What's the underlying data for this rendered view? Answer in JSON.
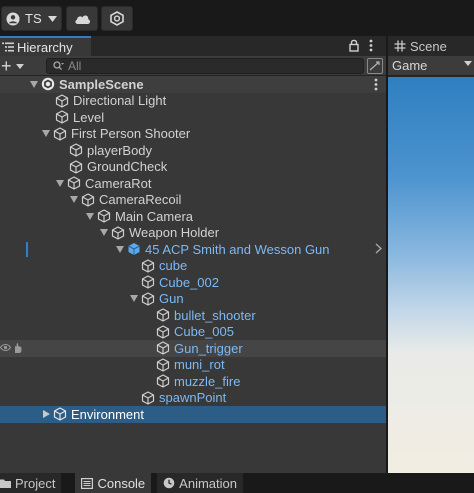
{
  "toolbar": {
    "account_label": "TS",
    "account_icon": "user-icon",
    "cloud_icon": "cloud-icon",
    "collab_icon": "collab-icon"
  },
  "hierarchy": {
    "tab_label": "Hierarchy",
    "add_label": "+",
    "search_placeholder": "All",
    "scene_name": "SampleScene",
    "items": [
      {
        "label": "Directional Light"
      },
      {
        "label": "Level"
      },
      {
        "label": "First Person Shooter"
      },
      {
        "label": "playerBody"
      },
      {
        "label": "GroundCheck"
      },
      {
        "label": "CameraRot"
      },
      {
        "label": "CameraRecoil"
      },
      {
        "label": "Main Camera"
      },
      {
        "label": "Weapon Holder"
      },
      {
        "label": "45 ACP Smith and Wesson Gun"
      },
      {
        "label": "cube"
      },
      {
        "label": "Cube_002"
      },
      {
        "label": "Gun"
      },
      {
        "label": "bullet_shooter"
      },
      {
        "label": "Cube_005"
      },
      {
        "label": "Gun_trigger"
      },
      {
        "label": "muni_rot"
      },
      {
        "label": "muzzle_fire"
      },
      {
        "label": "spawnPoint"
      },
      {
        "label": "Environment"
      }
    ]
  },
  "scene_panel": {
    "tab_label": "Scene",
    "game_label": "Game"
  },
  "bottom_tabs": [
    {
      "label": "Project"
    },
    {
      "label": "Console"
    },
    {
      "label": "Animation"
    }
  ],
  "colors": {
    "accent": "#3a79bb",
    "selection": "#2c5d87",
    "prefab_text": "#7cb9f5",
    "panel_bg": "#383838"
  }
}
